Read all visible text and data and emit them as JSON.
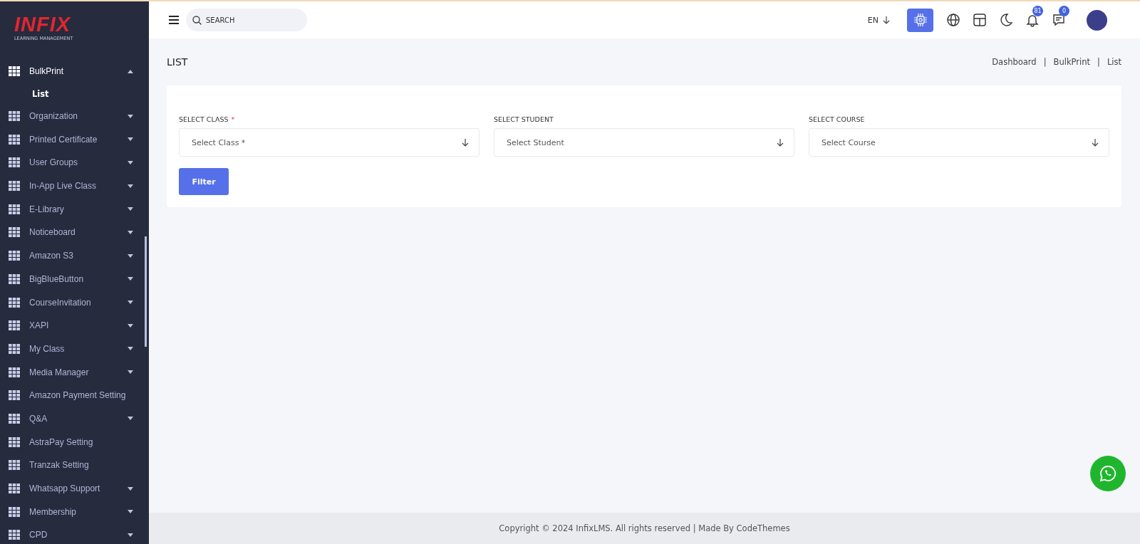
{
  "logo": {
    "name": "INFIX",
    "tagline": "LEARNING MANAGEMENT"
  },
  "sidebar": {
    "items": [
      {
        "label": "BulkPrint",
        "kind": "menu",
        "expanded": true,
        "children": [
          {
            "label": "List",
            "selected": true
          }
        ]
      },
      {
        "label": "Organization",
        "kind": "menu",
        "expanded": false
      },
      {
        "label": "Printed Certificate",
        "kind": "menu",
        "expanded": false
      },
      {
        "label": "User Groups",
        "kind": "menu",
        "expanded": false
      },
      {
        "label": "In-App Live Class",
        "kind": "menu",
        "expanded": false
      },
      {
        "label": "E-Library",
        "kind": "menu",
        "expanded": false
      },
      {
        "label": "Noticeboard",
        "kind": "menu",
        "expanded": false
      },
      {
        "label": "Amazon S3",
        "kind": "menu",
        "expanded": false
      },
      {
        "label": "BigBlueButton",
        "kind": "menu",
        "expanded": false
      },
      {
        "label": "CourseInvitation",
        "kind": "menu",
        "expanded": false
      },
      {
        "label": "XAPI",
        "kind": "menu",
        "expanded": false
      },
      {
        "label": "My Class",
        "kind": "menu",
        "expanded": false
      },
      {
        "label": "Media Manager",
        "kind": "menu",
        "expanded": false
      },
      {
        "label": "Amazon Payment Setting",
        "kind": "link"
      },
      {
        "label": "Q&A",
        "kind": "menu",
        "expanded": false
      },
      {
        "label": "AstraPay Setting",
        "kind": "link"
      },
      {
        "label": "Tranzak Setting",
        "kind": "link"
      },
      {
        "label": "Whatsapp Support",
        "kind": "menu",
        "expanded": false
      },
      {
        "label": "Membership",
        "kind": "menu",
        "expanded": false
      },
      {
        "label": "CPD",
        "kind": "menu",
        "expanded": false
      }
    ]
  },
  "header": {
    "search": {
      "placeholder": "SEARCH"
    },
    "language": "EN",
    "notifications_badge": "81",
    "messages_badge": "0"
  },
  "page": {
    "title": "LIST",
    "breadcrumb": [
      "Dashboard",
      "BulkPrint",
      "List"
    ],
    "breadcrumb_separator": "|"
  },
  "filters": [
    {
      "label": "SELECT CLASS",
      "required": true,
      "placeholder": "Select Class *"
    },
    {
      "label": "SELECT STUDENT",
      "required": false,
      "placeholder": "Select Student"
    },
    {
      "label": "SELECT COURSE",
      "required": false,
      "placeholder": "Select Course"
    }
  ],
  "required_mark": "*",
  "filter_button": "Filter",
  "footer": "Copyright © 2024 InfixLMS. All rights reserved | Made By CodeThemes"
}
